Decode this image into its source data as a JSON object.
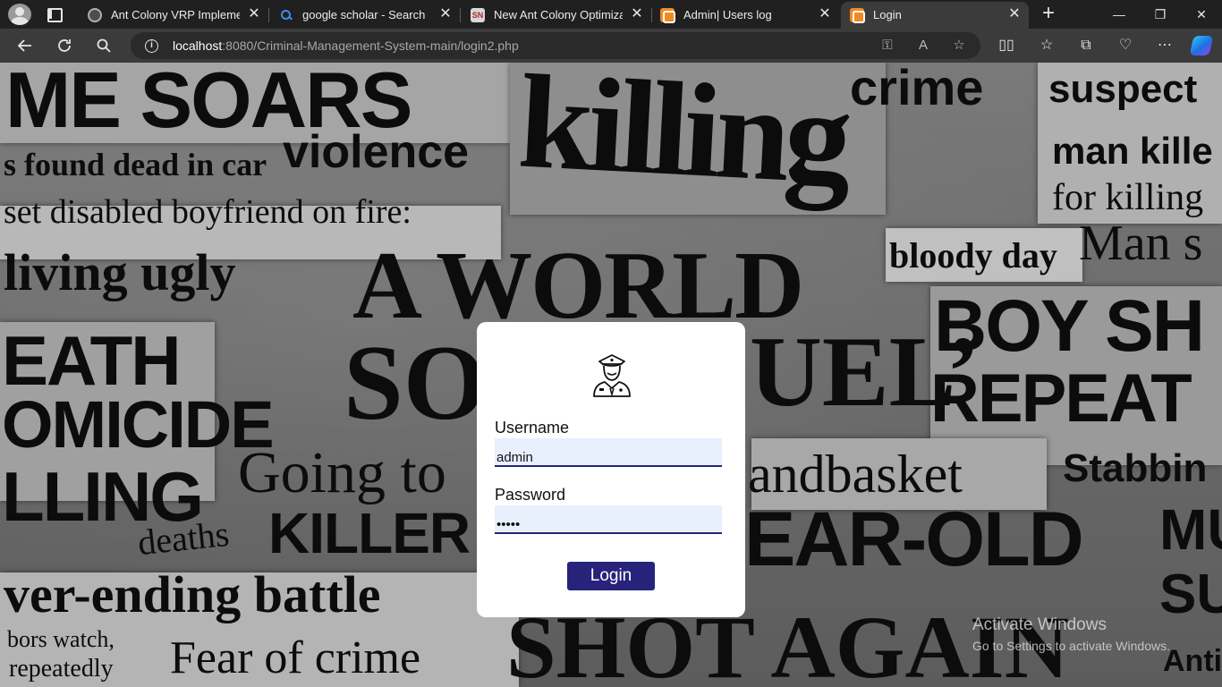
{
  "browser": {
    "tabs": [
      {
        "title": "Ant Colony VRP Implementa",
        "favicon": "ai-icon"
      },
      {
        "title": "google scholar - Search",
        "favicon": "search-icon"
      },
      {
        "title": "New Ant Colony Optimizatio",
        "favicon": "sn-icon",
        "favicon_text": "SN"
      },
      {
        "title": "Admin| Users log",
        "favicon": "xampp-icon"
      },
      {
        "title": "Login",
        "favicon": "xampp-icon",
        "active": true
      }
    ],
    "url_host": "localhost",
    "url_rest": ":8080/Criminal-Management-System-main/login2.php",
    "close_glyph": "✕",
    "new_tab_glyph": "+",
    "window_minimize": "—",
    "window_restore": "❐",
    "window_close": "✕"
  },
  "background": {
    "headlines": [
      "ME SOARS",
      "killing",
      "crime",
      "suspect",
      "violence",
      "s found dead in car",
      "man kille",
      "set disabled boyfriend on fire:",
      "for killing",
      "Man s",
      "bloody day",
      "living ugly",
      "A WORLD",
      "BOY SH",
      "EATH",
      "SO",
      "UEL’",
      "REPEAT",
      "OMICIDE",
      "Going to",
      "andbasket",
      "Stabbin",
      "LLING",
      "deaths",
      "KILLER",
      "EAR-OLD",
      "MU",
      "SU",
      "ver-ending battle",
      "bors watch,",
      "Fear of crime",
      "SHOT AGAIN",
      "repeatedly",
      "Anti-vi"
    ],
    "watermark_line1": "Activate Windows",
    "watermark_line2": "Go to Settings to activate Windows."
  },
  "login": {
    "icon": "police-officer-icon",
    "username_label": "Username",
    "username_value": "admin",
    "password_label": "Password",
    "password_value": "•••••",
    "button_label": "Login"
  },
  "colors": {
    "button": "#27237a",
    "field_bg": "#e8f0fe",
    "browser_bg": "#202020",
    "toolbar_bg": "#3b3b3b"
  }
}
